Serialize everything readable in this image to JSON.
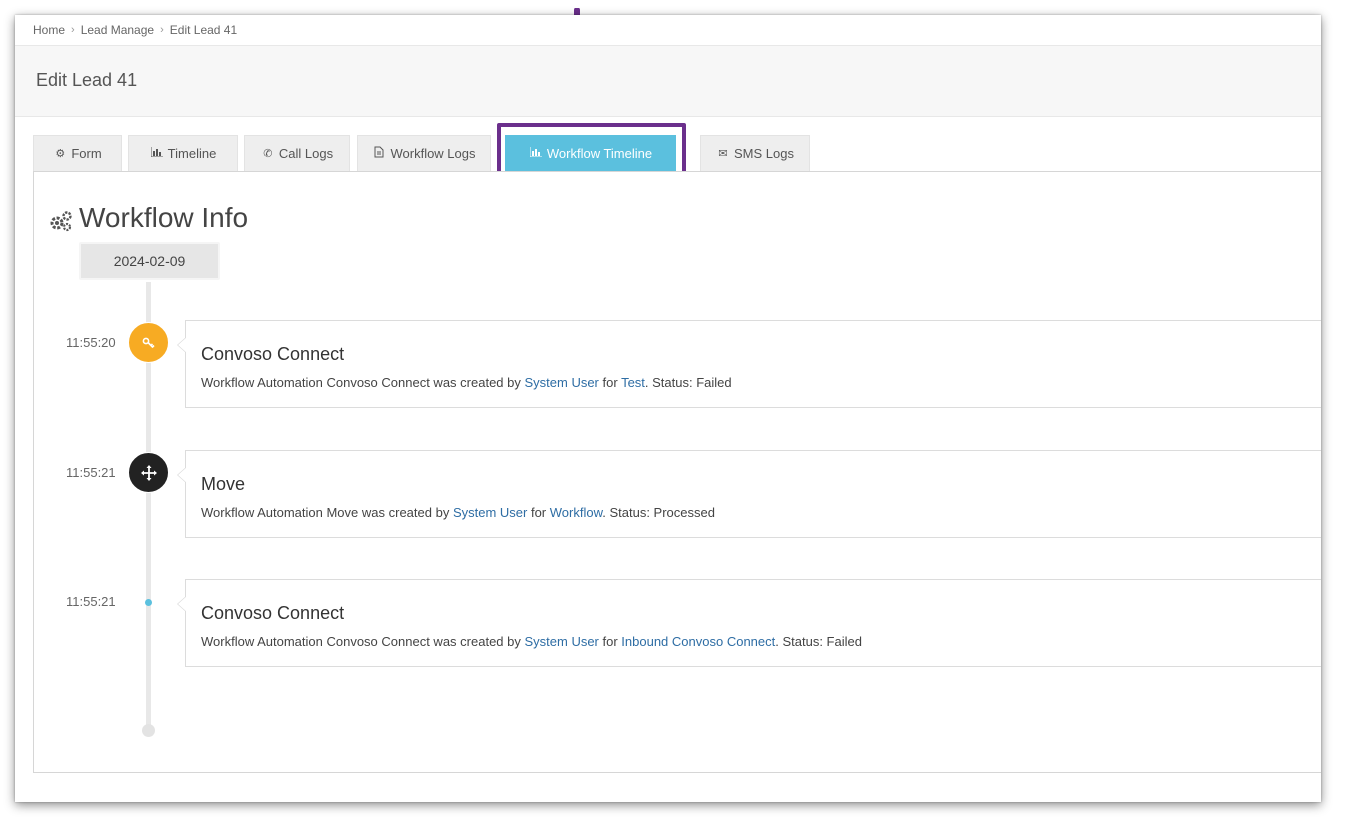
{
  "breadcrumb": [
    "Home",
    "Lead Manage",
    "Edit Lead 41"
  ],
  "page_title": "Edit Lead 41",
  "tabs": [
    {
      "label": "Form",
      "icon": "gears-icon"
    },
    {
      "label": "Timeline",
      "icon": "bar-chart-icon"
    },
    {
      "label": "Call Logs",
      "icon": "phone-icon"
    },
    {
      "label": "Workflow Logs",
      "icon": "document-icon"
    },
    {
      "label": "Workflow Timeline",
      "icon": "bar-chart-icon",
      "active": true
    },
    {
      "label": "SMS Logs",
      "icon": "envelope-icon"
    }
  ],
  "panel_title": "Workflow Info",
  "date": "2024-02-09",
  "events": [
    {
      "time": "11:55:20",
      "icon": "key-icon",
      "title": "Convoso Connect",
      "text_prefix": "Workflow Automation Convoso Connect was created by ",
      "user": "System User",
      "text_mid": " for ",
      "target": "Test",
      "text_suffix": ". Status: Failed"
    },
    {
      "time": "11:55:21",
      "icon": "move-icon",
      "title": "Move",
      "text_prefix": "Workflow Automation Move was created by ",
      "user": "System User",
      "text_mid": " for ",
      "target": "Workflow",
      "text_suffix": ". Status: Processed"
    },
    {
      "time": "11:55:21",
      "icon": "dot-icon",
      "title": "Convoso Connect",
      "text_prefix": "Workflow Automation Convoso Connect was created by ",
      "user": "System User",
      "text_mid": " for ",
      "target": "Inbound Convoso Connect",
      "text_suffix": ". Status: Failed"
    }
  ],
  "colors": {
    "active_tab": "#5bc0de",
    "highlight": "#6b2f8c",
    "node_orange": "#f7ab23",
    "node_dark": "#222222",
    "link": "#2e6da4"
  }
}
